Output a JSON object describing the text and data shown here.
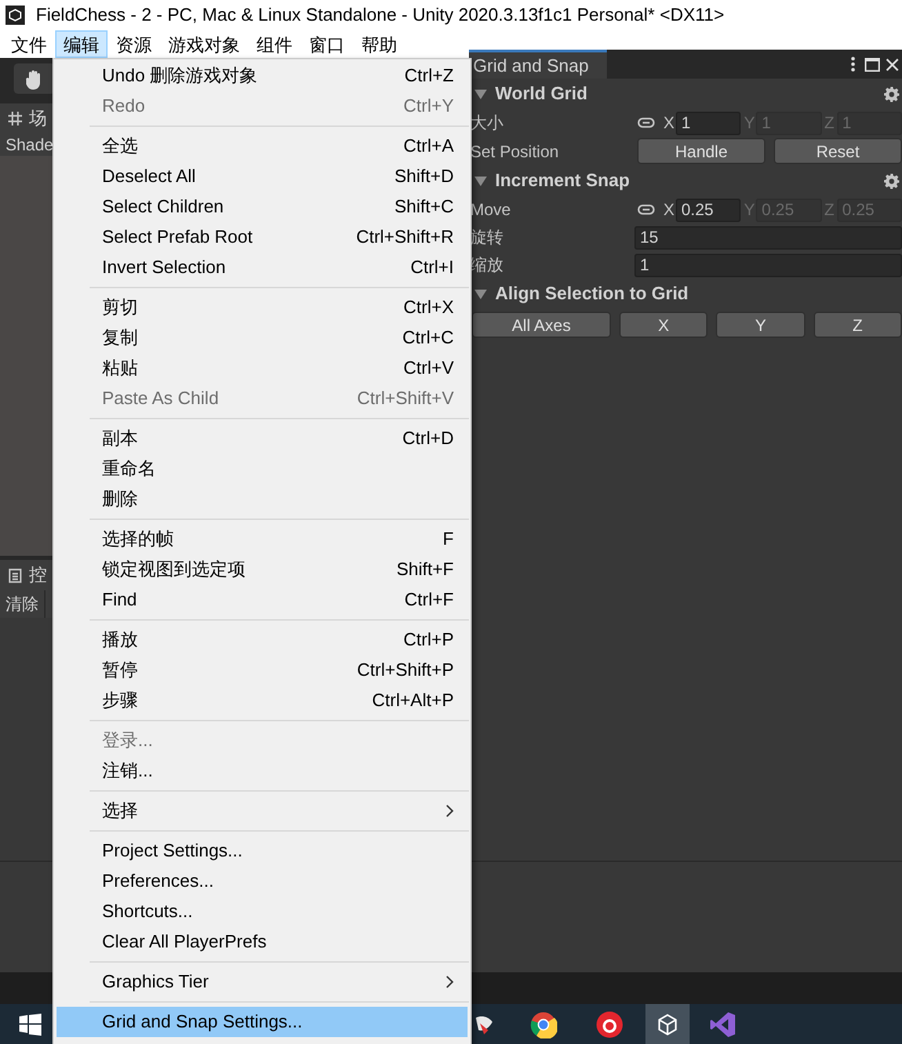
{
  "window": {
    "title": "FieldChess - 2 - PC, Mac & Linux Standalone - Unity 2020.3.13f1c1 Personal* <DX11>"
  },
  "menubar": [
    {
      "label": "文件",
      "selected": false
    },
    {
      "label": "编辑",
      "selected": true
    },
    {
      "label": "资源",
      "selected": false
    },
    {
      "label": "游戏对象",
      "selected": false
    },
    {
      "label": "组件",
      "selected": false
    },
    {
      "label": "窗口",
      "selected": false
    },
    {
      "label": "帮助",
      "selected": false
    }
  ],
  "scene_panel": {
    "tab": "场",
    "shading": "Shade"
  },
  "console_panel": {
    "tab": "控",
    "clear_button": "清除"
  },
  "edit_menu": [
    {
      "kind": "item",
      "label": "Undo 删除游戏对象",
      "shortcut": "Ctrl+Z",
      "disabled": false,
      "selected": false
    },
    {
      "kind": "item",
      "label": "Redo",
      "shortcut": "Ctrl+Y",
      "disabled": true,
      "selected": false
    },
    {
      "kind": "separator"
    },
    {
      "kind": "item",
      "label": "全选",
      "shortcut": "Ctrl+A",
      "disabled": false,
      "selected": false
    },
    {
      "kind": "item",
      "label": "Deselect All",
      "shortcut": "Shift+D",
      "disabled": false,
      "selected": false
    },
    {
      "kind": "item",
      "label": "Select Children",
      "shortcut": "Shift+C",
      "disabled": false,
      "selected": false
    },
    {
      "kind": "item",
      "label": "Select Prefab Root",
      "shortcut": "Ctrl+Shift+R",
      "disabled": false,
      "selected": false
    },
    {
      "kind": "item",
      "label": "Invert Selection",
      "shortcut": "Ctrl+I",
      "disabled": false,
      "selected": false
    },
    {
      "kind": "separator"
    },
    {
      "kind": "item",
      "label": "剪切",
      "shortcut": "Ctrl+X",
      "disabled": false,
      "selected": false
    },
    {
      "kind": "item",
      "label": "复制",
      "shortcut": "Ctrl+C",
      "disabled": false,
      "selected": false
    },
    {
      "kind": "item",
      "label": "粘贴",
      "shortcut": "Ctrl+V",
      "disabled": false,
      "selected": false
    },
    {
      "kind": "item",
      "label": "Paste As Child",
      "shortcut": "Ctrl+Shift+V",
      "disabled": true,
      "selected": false
    },
    {
      "kind": "separator"
    },
    {
      "kind": "item",
      "label": "副本",
      "shortcut": "Ctrl+D",
      "disabled": false,
      "selected": false
    },
    {
      "kind": "item",
      "label": "重命名",
      "disabled": false,
      "selected": false
    },
    {
      "kind": "item",
      "label": "删除",
      "disabled": false,
      "selected": false
    },
    {
      "kind": "separator"
    },
    {
      "kind": "item",
      "label": "选择的帧",
      "shortcut": "F",
      "disabled": false,
      "selected": false
    },
    {
      "kind": "item",
      "label": "锁定视图到选定项",
      "shortcut": "Shift+F",
      "disabled": false,
      "selected": false
    },
    {
      "kind": "item",
      "label": "Find",
      "shortcut": "Ctrl+F",
      "disabled": false,
      "selected": false
    },
    {
      "kind": "separator"
    },
    {
      "kind": "item",
      "label": "播放",
      "shortcut": "Ctrl+P",
      "disabled": false,
      "selected": false
    },
    {
      "kind": "item",
      "label": "暂停",
      "shortcut": "Ctrl+Shift+P",
      "disabled": false,
      "selected": false
    },
    {
      "kind": "item",
      "label": "步骤",
      "shortcut": "Ctrl+Alt+P",
      "disabled": false,
      "selected": false
    },
    {
      "kind": "separator"
    },
    {
      "kind": "item",
      "label": "登录...",
      "disabled": true,
      "selected": false
    },
    {
      "kind": "item",
      "label": "注销...",
      "disabled": false,
      "selected": false
    },
    {
      "kind": "separator"
    },
    {
      "kind": "submenu",
      "label": "选择",
      "disabled": false,
      "selected": false
    },
    {
      "kind": "separator"
    },
    {
      "kind": "item",
      "label": "Project Settings...",
      "disabled": false,
      "selected": false
    },
    {
      "kind": "item",
      "label": "Preferences...",
      "disabled": false,
      "selected": false
    },
    {
      "kind": "item",
      "label": "Shortcuts...",
      "disabled": false,
      "selected": false
    },
    {
      "kind": "item",
      "label": "Clear All PlayerPrefs",
      "disabled": false,
      "selected": false
    },
    {
      "kind": "separator"
    },
    {
      "kind": "submenu",
      "label": "Graphics Tier",
      "disabled": false,
      "selected": false
    },
    {
      "kind": "separator"
    },
    {
      "kind": "item",
      "label": "Grid and Snap Settings...",
      "disabled": false,
      "selected": true
    }
  ],
  "grid_panel": {
    "tab": "Grid and Snap",
    "sections": [
      {
        "title": "World Grid",
        "settings": true,
        "rows": [
          {
            "kind": "vector",
            "label": "大小",
            "fields": [
              {
                "axis": "X",
                "value": "1",
                "disabled": false
              },
              {
                "axis": "Y",
                "value": "1",
                "disabled": true
              },
              {
                "axis": "Z",
                "value": "1",
                "disabled": true
              }
            ]
          },
          {
            "kind": "buttons",
            "label": "Set Position",
            "buttons": [
              "Handle",
              "Reset"
            ]
          }
        ]
      },
      {
        "title": "Increment Snap",
        "settings": true,
        "rows": [
          {
            "kind": "vector",
            "label": "Move",
            "fields": [
              {
                "axis": "X",
                "value": "0.25",
                "disabled": false
              },
              {
                "axis": "Y",
                "value": "0.25",
                "disabled": true
              },
              {
                "axis": "Z",
                "value": "0.25",
                "disabled": true
              }
            ]
          },
          {
            "kind": "field",
            "label": "旋转",
            "value": "15"
          },
          {
            "kind": "field",
            "label": "缩放",
            "value": "1"
          }
        ]
      },
      {
        "title": "Align Selection to Grid",
        "settings": false,
        "rows": [
          {
            "kind": "button_row",
            "buttons": [
              "All Axes",
              "X",
              "Y",
              "Z"
            ]
          }
        ]
      }
    ]
  }
}
